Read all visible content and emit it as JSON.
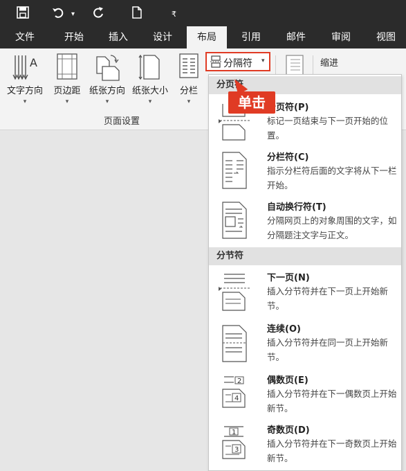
{
  "quick_access": {
    "save_icon": "save-icon",
    "undo_icon": "undo-icon",
    "undo_dropdown": "▾",
    "redo_icon": "redo-icon",
    "new_doc_icon": "new-document-icon",
    "customize": "₹"
  },
  "tabs": [
    {
      "label": "文件"
    },
    {
      "label": "开始"
    },
    {
      "label": "插入"
    },
    {
      "label": "设计"
    },
    {
      "label": "布局",
      "active": true
    },
    {
      "label": "引用"
    },
    {
      "label": "邮件"
    },
    {
      "label": "审阅"
    },
    {
      "label": "视图"
    }
  ],
  "ribbon": {
    "buttons": [
      {
        "label": "文字方向",
        "icon": "text-direction-icon"
      },
      {
        "label": "页边距",
        "icon": "margins-icon"
      },
      {
        "label": "纸张方向",
        "icon": "orientation-icon"
      },
      {
        "label": "纸张大小",
        "icon": "size-icon"
      },
      {
        "label": "分栏",
        "icon": "columns-icon"
      }
    ],
    "dropdown_arrow": "▾",
    "group_label": "页面设置",
    "breaks_button": {
      "label": "分隔符",
      "icon": "breaks-icon"
    },
    "indent_label": "缩进"
  },
  "menu": {
    "page_breaks_header": "分页符",
    "section_breaks_header": "分节符",
    "items": [
      {
        "title": "分页符(P)",
        "desc": "标记一页结束与下一页开始的位置。",
        "icon": "page-break-icon"
      },
      {
        "title": "分栏符(C)",
        "desc": "指示分栏符后面的文字将从下一栏开始。",
        "icon": "column-break-icon"
      },
      {
        "title": "自动换行符(T)",
        "desc": "分隔网页上的对象周围的文字，如分隔题注文字与正文。",
        "icon": "text-wrapping-break-icon"
      },
      {
        "title": "下一页(N)",
        "desc": "插入分节符并在下一页上开始新节。",
        "icon": "next-page-break-icon"
      },
      {
        "title": "连续(O)",
        "desc": "插入分节符并在同一页上开始新节。",
        "icon": "continuous-break-icon"
      },
      {
        "title": "偶数页(E)",
        "desc": "插入分节符并在下一偶数页上开始新节。",
        "icon": "even-page-break-icon"
      },
      {
        "title": "奇数页(D)",
        "desc": "插入分节符并在下一奇数页上开始新节。",
        "icon": "odd-page-break-icon"
      }
    ]
  },
  "callout": {
    "label": "单击"
  },
  "colors": {
    "title_bar": "#2b2b2b",
    "ribbon": "#f3f3f3",
    "highlight": "#e03b24"
  }
}
